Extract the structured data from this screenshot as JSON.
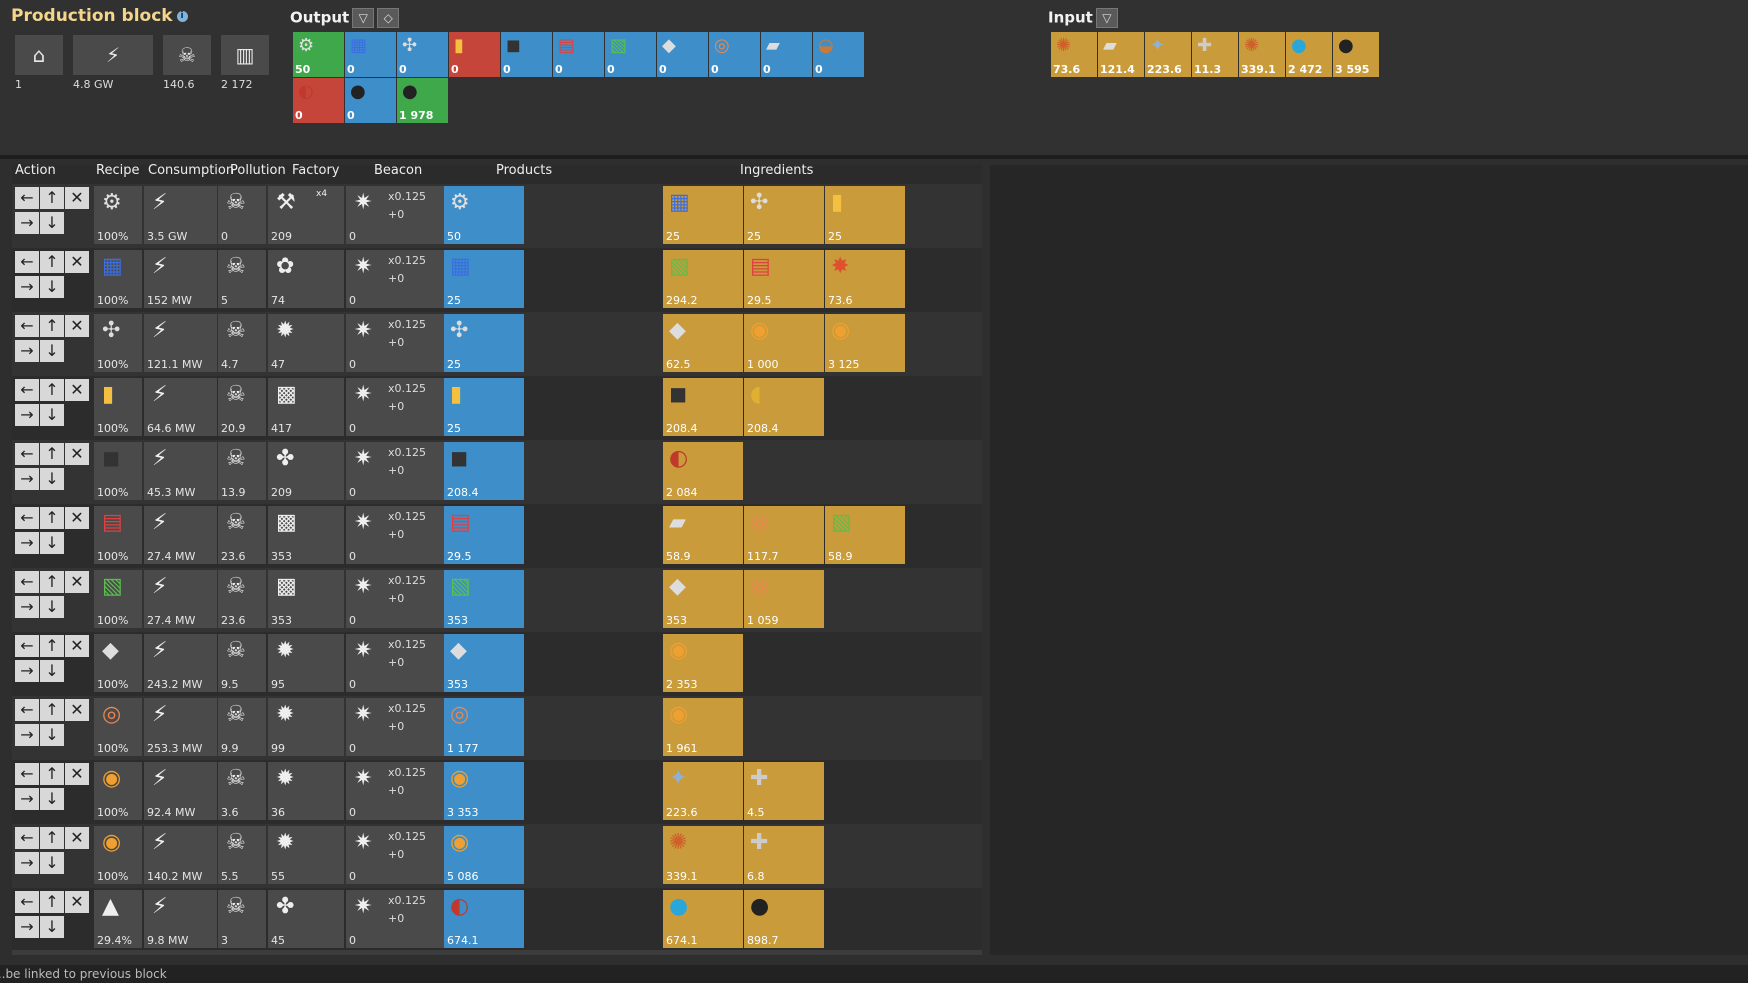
{
  "header": {
    "title": "Production block",
    "summary": [
      {
        "icon": "home-icon",
        "value": "1"
      },
      {
        "icon": "lightning-icon",
        "value": "4.8 GW"
      },
      {
        "icon": "skull-icon",
        "value": "140.6"
      },
      {
        "icon": "factory-icon",
        "value": "2 172"
      }
    ]
  },
  "output": {
    "label": "Output",
    "tiles": [
      {
        "icon": "rocket-part-icon",
        "value": "50",
        "color": "green"
      },
      {
        "icon": "processing-unit-icon",
        "value": "0",
        "color": "blue"
      },
      {
        "icon": "low-density-structure-icon",
        "value": "0",
        "color": "blue"
      },
      {
        "icon": "rocket-fuel-icon",
        "value": "0",
        "color": "red"
      },
      {
        "icon": "plastic-bar-icon",
        "value": "0",
        "color": "blue"
      },
      {
        "icon": "advanced-circuit-icon",
        "value": "0",
        "color": "blue"
      },
      {
        "icon": "electronic-circuit-icon",
        "value": "0",
        "color": "blue"
      },
      {
        "icon": "steel-plate-icon",
        "value": "0",
        "color": "blue"
      },
      {
        "icon": "copper-cable-icon",
        "value": "0",
        "color": "blue"
      },
      {
        "icon": "iron-plate-icon",
        "value": "0",
        "color": "blue"
      },
      {
        "icon": "copper-plate-icon",
        "value": "0",
        "color": "blue"
      },
      {
        "icon": "petroleum-gas-icon",
        "value": "0",
        "color": "red"
      },
      {
        "icon": "crude-oil-icon",
        "value": "0",
        "color": "blue"
      },
      {
        "icon": "coal-icon",
        "value": "1 978",
        "color": "green"
      }
    ]
  },
  "input": {
    "label": "Input",
    "tiles": [
      {
        "icon": "copper-ore-icon",
        "value": "73.6"
      },
      {
        "icon": "iron-plate-icon",
        "value": "121.4"
      },
      {
        "icon": "iron-ore-icon",
        "value": "223.6"
      },
      {
        "icon": "stone-icon",
        "value": "11.3"
      },
      {
        "icon": "copper-ore-icon",
        "value": "339.1"
      },
      {
        "icon": "water-icon",
        "value": "2 472"
      },
      {
        "icon": "crude-oil-icon",
        "value": "3 595"
      }
    ]
  },
  "table": {
    "headers": {
      "action": "Action",
      "recipe": "Recipe",
      "consumption": "Consumption",
      "pollution": "Pollution",
      "factory": "Factory",
      "beacon": "Beacon",
      "products": "Products",
      "ingredients": "Ingredients"
    },
    "rows": [
      {
        "recipe_icon": "rocket-part-icon",
        "pct": "100%",
        "consumption": "3.5 GW",
        "pollution": "0",
        "factory": "209",
        "factory_icon": "rocket-silo-icon",
        "factory_extra": "x4",
        "beacon_mult": "x0.125",
        "beacon_plus": "+0",
        "beacon_count": "0",
        "products": [
          {
            "icon": "rocket-part-icon",
            "value": "50"
          }
        ],
        "ingredients": [
          {
            "icon": "processing-unit-icon",
            "value": "25"
          },
          {
            "icon": "low-density-structure-icon",
            "value": "25"
          },
          {
            "icon": "rocket-fuel-icon",
            "value": "25"
          }
        ]
      },
      {
        "recipe_icon": "processing-unit-icon",
        "pct": "100%",
        "consumption": "152 MW",
        "pollution": "5",
        "factory": "74",
        "factory_icon": "assembling-machine-icon",
        "factory_extra": "",
        "beacon_mult": "x0.125",
        "beacon_plus": "+0",
        "beacon_count": "0",
        "products": [
          {
            "icon": "processing-unit-icon",
            "value": "25"
          }
        ],
        "ingredients": [
          {
            "icon": "electronic-circuit-icon",
            "value": "294.2"
          },
          {
            "icon": "advanced-circuit-icon",
            "value": "29.5"
          },
          {
            "icon": "sulfuric-acid-icon",
            "value": "73.6"
          }
        ]
      },
      {
        "recipe_icon": "low-density-structure-icon",
        "pct": "100%",
        "consumption": "121.1 MW",
        "pollution": "4.7",
        "factory": "47",
        "factory_icon": "furnace-icon",
        "factory_extra": "",
        "beacon_mult": "x0.125",
        "beacon_plus": "+0",
        "beacon_count": "0",
        "products": [
          {
            "icon": "low-density-structure-icon",
            "value": "25"
          }
        ],
        "ingredients": [
          {
            "icon": "steel-plate-icon",
            "value": "62.5"
          },
          {
            "icon": "molten-copper-icon",
            "value": "1 000"
          },
          {
            "icon": "molten-iron-icon",
            "value": "3 125"
          }
        ]
      },
      {
        "recipe_icon": "rocket-fuel-icon",
        "pct": "100%",
        "consumption": "64.6 MW",
        "pollution": "20.9",
        "factory": "417",
        "factory_icon": "assembler-icon",
        "factory_extra": "",
        "beacon_mult": "x0.125",
        "beacon_plus": "+0",
        "beacon_count": "0",
        "products": [
          {
            "icon": "rocket-fuel-icon",
            "value": "25"
          }
        ],
        "ingredients": [
          {
            "icon": "plastic-bar-icon",
            "value": "208.4"
          },
          {
            "icon": "light-oil-icon",
            "value": "208.4"
          }
        ]
      },
      {
        "recipe_icon": "plastic-bar-icon",
        "pct": "100%",
        "consumption": "45.3 MW",
        "pollution": "13.9",
        "factory": "209",
        "factory_icon": "chemical-plant-icon",
        "factory_extra": "",
        "beacon_mult": "x0.125",
        "beacon_plus": "+0",
        "beacon_count": "0",
        "products": [
          {
            "icon": "plastic-bar-icon",
            "value": "208.4"
          }
        ],
        "ingredients": [
          {
            "icon": "petroleum-gas-icon",
            "value": "2 084"
          }
        ]
      },
      {
        "recipe_icon": "advanced-circuit-icon",
        "pct": "100%",
        "consumption": "27.4 MW",
        "pollution": "23.6",
        "factory": "353",
        "factory_icon": "assembler-icon",
        "factory_extra": "",
        "beacon_mult": "x0.125",
        "beacon_plus": "+0",
        "beacon_count": "0",
        "products": [
          {
            "icon": "advanced-circuit-icon",
            "value": "29.5"
          }
        ],
        "ingredients": [
          {
            "icon": "iron-plate-icon",
            "value": "58.9"
          },
          {
            "icon": "copper-cable-icon",
            "value": "117.7"
          },
          {
            "icon": "electronic-circuit-icon",
            "value": "58.9"
          }
        ]
      },
      {
        "recipe_icon": "electronic-circuit-icon",
        "pct": "100%",
        "consumption": "27.4 MW",
        "pollution": "23.6",
        "factory": "353",
        "factory_icon": "assembler-icon",
        "factory_extra": "",
        "beacon_mult": "x0.125",
        "beacon_plus": "+0",
        "beacon_count": "0",
        "products": [
          {
            "icon": "electronic-circuit-icon",
            "value": "353"
          }
        ],
        "ingredients": [
          {
            "icon": "steel-plate-icon",
            "value": "353"
          },
          {
            "icon": "copper-cable-icon",
            "value": "1 059"
          }
        ]
      },
      {
        "recipe_icon": "steel-plate-icon",
        "pct": "100%",
        "consumption": "243.2 MW",
        "pollution": "9.5",
        "factory": "95",
        "factory_icon": "furnace-icon",
        "factory_extra": "",
        "beacon_mult": "x0.125",
        "beacon_plus": "+0",
        "beacon_count": "0",
        "products": [
          {
            "icon": "steel-plate-icon",
            "value": "353"
          }
        ],
        "ingredients": [
          {
            "icon": "molten-iron-icon",
            "value": "2 353"
          }
        ]
      },
      {
        "recipe_icon": "copper-cable-icon",
        "pct": "100%",
        "consumption": "253.3 MW",
        "pollution": "9.9",
        "factory": "99",
        "factory_icon": "furnace-icon",
        "factory_extra": "",
        "beacon_mult": "x0.125",
        "beacon_plus": "+0",
        "beacon_count": "0",
        "products": [
          {
            "icon": "copper-cable-icon",
            "value": "1 177"
          }
        ],
        "ingredients": [
          {
            "icon": "molten-copper-icon",
            "value": "1 961"
          }
        ]
      },
      {
        "recipe_icon": "molten-iron-icon",
        "pct": "100%",
        "consumption": "92.4 MW",
        "pollution": "3.6",
        "factory": "36",
        "factory_icon": "furnace-icon",
        "factory_extra": "",
        "beacon_mult": "x0.125",
        "beacon_plus": "+0",
        "beacon_count": "0",
        "products": [
          {
            "icon": "molten-iron-icon",
            "value": "3 353"
          }
        ],
        "ingredients": [
          {
            "icon": "iron-ore-icon",
            "value": "223.6"
          },
          {
            "icon": "stone-icon",
            "value": "4.5"
          }
        ]
      },
      {
        "recipe_icon": "molten-copper-icon",
        "pct": "100%",
        "consumption": "140.2 MW",
        "pollution": "5.5",
        "factory": "55",
        "factory_icon": "furnace-icon",
        "factory_extra": "",
        "beacon_mult": "x0.125",
        "beacon_plus": "+0",
        "beacon_count": "0",
        "products": [
          {
            "icon": "molten-copper-icon",
            "value": "5 086"
          }
        ],
        "ingredients": [
          {
            "icon": "copper-ore-icon",
            "value": "339.1"
          },
          {
            "icon": "stone-icon",
            "value": "6.8"
          }
        ]
      },
      {
        "recipe_icon": "oil-processing-icon",
        "pct": "29.4%",
        "consumption": "9.8 MW",
        "pollution": "3",
        "factory": "45",
        "factory_icon": "oil-refinery-icon",
        "factory_extra": "",
        "beacon_mult": "x0.125",
        "beacon_plus": "+0",
        "beacon_count": "0",
        "products": [
          {
            "icon": "petroleum-gas-icon",
            "value": "674.1"
          }
        ],
        "ingredients": [
          {
            "icon": "water-icon",
            "value": "674.1"
          },
          {
            "icon": "crude-oil-icon",
            "value": "898.7"
          }
        ]
      }
    ]
  },
  "footer": {
    "text": "...be linked to previous block"
  },
  "colors": {
    "blue": "#3e8fc9",
    "red": "#c6453a",
    "green": "#3ea84a",
    "gold": "#c99b3a"
  }
}
